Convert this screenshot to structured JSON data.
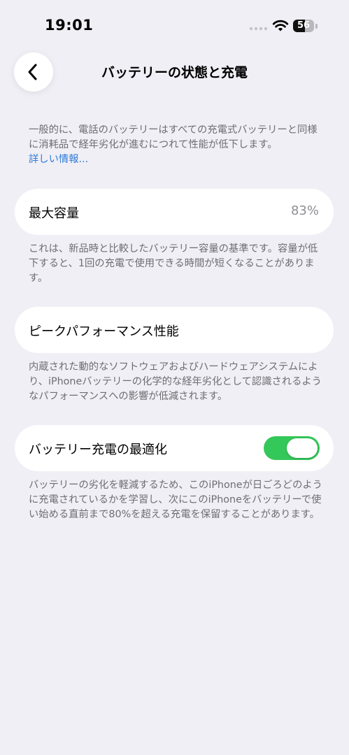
{
  "status_bar": {
    "time": "19:01",
    "battery_level": "56",
    "battery_fraction": 0.56,
    "icons": [
      "signal-dots-icon",
      "wifi-icon",
      "battery-icon"
    ]
  },
  "nav": {
    "back_icon": "chevron-left-icon",
    "title": "バッテリーの状態と充電"
  },
  "intro": {
    "text": "一般的に、電話のバッテリーはすべての充電式バッテリーと同様に消耗品で経年劣化が進むにつれて性能が低下します。",
    "link": "詳しい情報..."
  },
  "max_capacity": {
    "label": "最大容量",
    "value": "83%",
    "note": "これは、新品時と比較したバッテリー容量の基準です。容量が低下すると、1回の充電で使用できる時間が短くなることがあります。"
  },
  "peak_performance": {
    "label": "ピークパフォーマンス性能",
    "note": "内蔵された動的なソフトウェアおよびハードウェアシステムにより、iPhoneバッテリーの化学的な経年劣化として認識されるようなパフォーマンスへの影響が低減されます。"
  },
  "optimized_charging": {
    "label": "バッテリー充電の最適化",
    "enabled": true,
    "note": "バッテリーの劣化を軽減するため、このiPhoneが日ごろどのように充電されているかを学習し、次にこのiPhoneをバッテリーで使い始める直前まで80%を超える充電を保留することがあります。"
  },
  "colors": {
    "background": "#f0eff5",
    "card": "#ffffff",
    "link": "#2f7bd9",
    "toggle_on": "#34c759",
    "secondary_text": "#6d6d72"
  }
}
